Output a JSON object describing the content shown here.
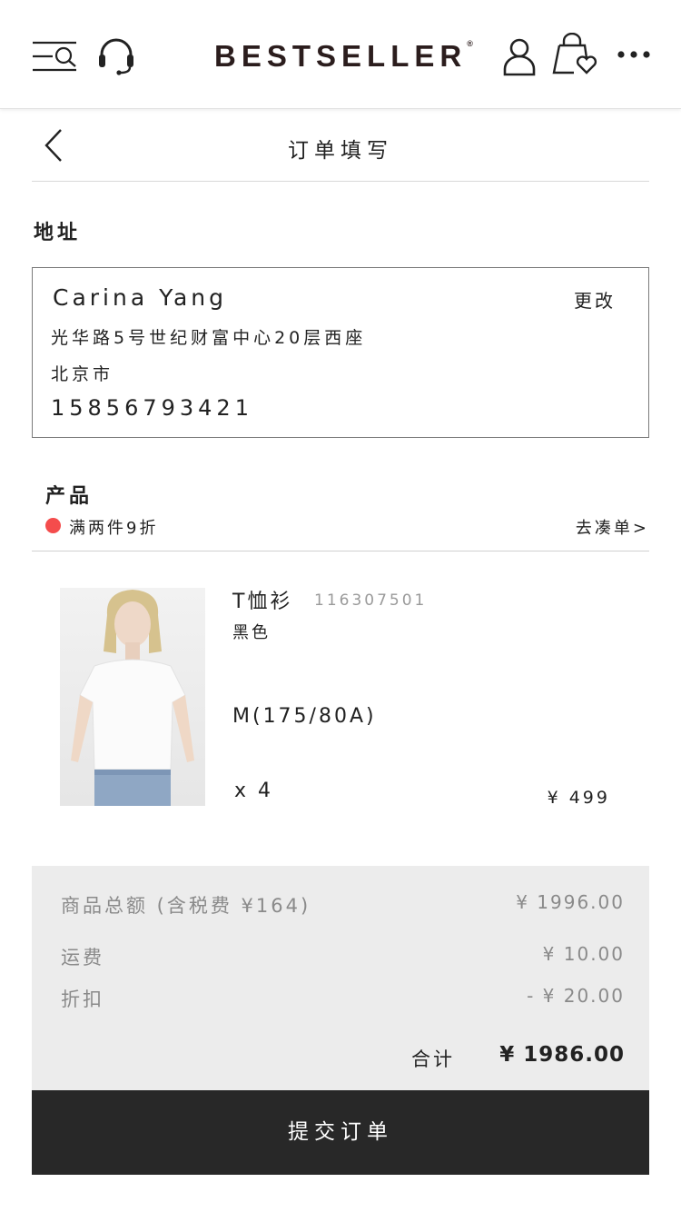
{
  "header": {
    "brand": "BESTSELLER",
    "brand_mark": "®",
    "icons": [
      "menu-search-icon",
      "headset-icon",
      "user-icon",
      "shopping-bag-heart-icon",
      "more-icon"
    ]
  },
  "page": {
    "title": "订单填写",
    "back_icon": "chevron-left-icon"
  },
  "address": {
    "section_label": "地址",
    "name": "Carina Yang",
    "change_label": "更改",
    "street": "光华路5号世纪财富中心20层西座",
    "city": "北京市",
    "phone": "15856793421"
  },
  "products": {
    "section_label": "产品",
    "promo_text": "满两件9折",
    "promo_link": "去凑单>",
    "promo_color": "#f44c4c",
    "items": [
      {
        "name": "T恤衫",
        "sku": "116307501",
        "color": "黑色",
        "size": "M(175/80A)",
        "qty": "x 4",
        "price": "¥ 499"
      }
    ]
  },
  "summary": {
    "subtotal_label": "商品总额 (含税费 ¥164)",
    "subtotal_value": "¥ 1996.00",
    "shipping_label": "运费",
    "shipping_value": "¥ 10.00",
    "discount_label": "折扣",
    "discount_value": "- ¥ 20.00",
    "total_label": "合计",
    "total_value": "¥ 1986.00"
  },
  "actions": {
    "submit_label": "提交订单"
  }
}
